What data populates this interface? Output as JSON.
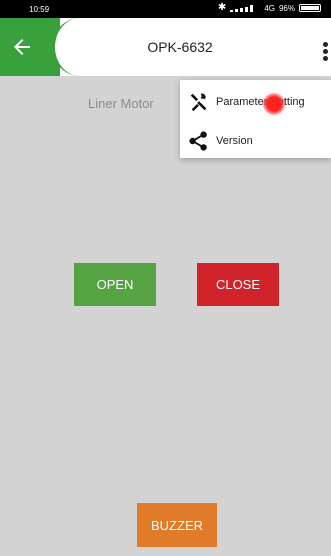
{
  "status_bar": {
    "time": "10:59",
    "network": "4G",
    "battery": "96%"
  },
  "app_bar": {
    "title": "OPK-6632",
    "back_icon": "arrow-left-icon",
    "more_icon": "more-vert-icon"
  },
  "device": {
    "type_label": "Liner Motor"
  },
  "menu": {
    "items": [
      {
        "icon": "tools-icon",
        "label": "Parameter Setting"
      },
      {
        "icon": "share-icon",
        "label": "Version"
      }
    ]
  },
  "controls": {
    "open_label": "OPEN",
    "close_label": "CLOSE",
    "buzzer_label": "BUZZER"
  },
  "colors": {
    "accent_green": "#39a13b",
    "open": "#56a343",
    "close": "#d0232a",
    "buzzer": "#e07b2a",
    "background": "#d3d3d3"
  }
}
